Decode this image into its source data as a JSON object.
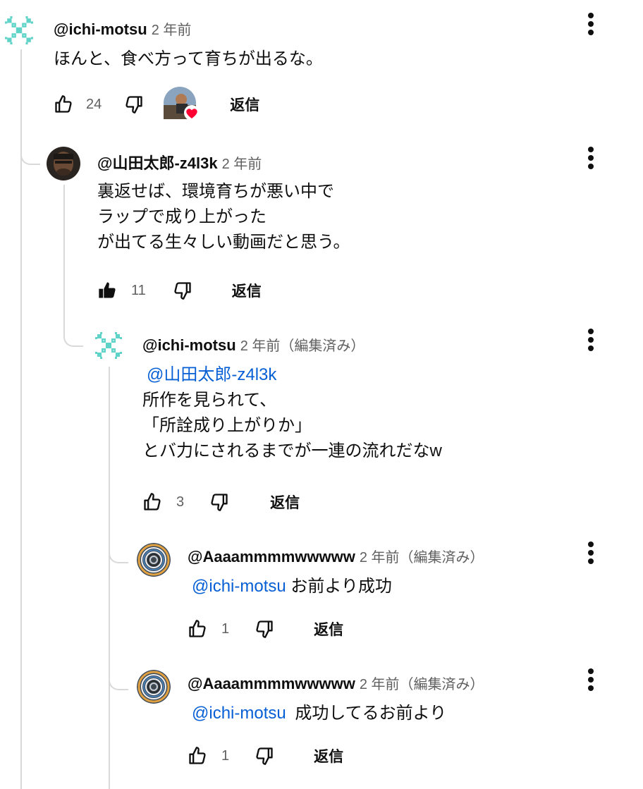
{
  "comments": [
    {
      "handle": "@ichi-motsu",
      "time": "2 年前",
      "lines": [
        "ほんと、食べ方って育ちが出るな。"
      ],
      "likes": "24",
      "reply_label": "返信"
    },
    {
      "handle": "@山田太郎-z4l3k",
      "time": "2 年前",
      "lines": [
        "裏返せば、環境育ちが悪い中で",
        "ラップで成り上がった",
        "が出てる生々しい動画だと思う。"
      ],
      "likes": "11",
      "reply_label": "返信"
    },
    {
      "handle": "@ichi-motsu",
      "time": "2 年前（編集済み）",
      "mention": "@山田太郎-z4l3k",
      "lines": [
        "所作を見られて、",
        "「所詮成り上がりか」",
        "とバ力にされるまでが一連の流れだなw"
      ],
      "likes": "3",
      "reply_label": "返信"
    },
    {
      "handle": "@Aaaammmmwwwww",
      "time": "2 年前（編集済み）",
      "mention": "@ichi-motsu",
      "body": "お前より成功",
      "likes": "1",
      "reply_label": "返信"
    },
    {
      "handle": "@Aaaammmmwwwww",
      "time": "2 年前（編集済み）",
      "mention": "@ichi-motsu",
      "body": "成功してるお前より",
      "likes": "1",
      "reply_label": "返信"
    }
  ],
  "icons": {
    "like": "thumbs-up-outline-icon",
    "like_filled": "thumbs-up-filled-icon",
    "dislike": "thumbs-down-outline-icon",
    "more": "more-vert-icon",
    "creator_heart": "heart-icon"
  },
  "colors": {
    "mention": "#065fd4",
    "heart": "#ff0033",
    "meta": "#606060",
    "thread": "#d9d9d9"
  }
}
